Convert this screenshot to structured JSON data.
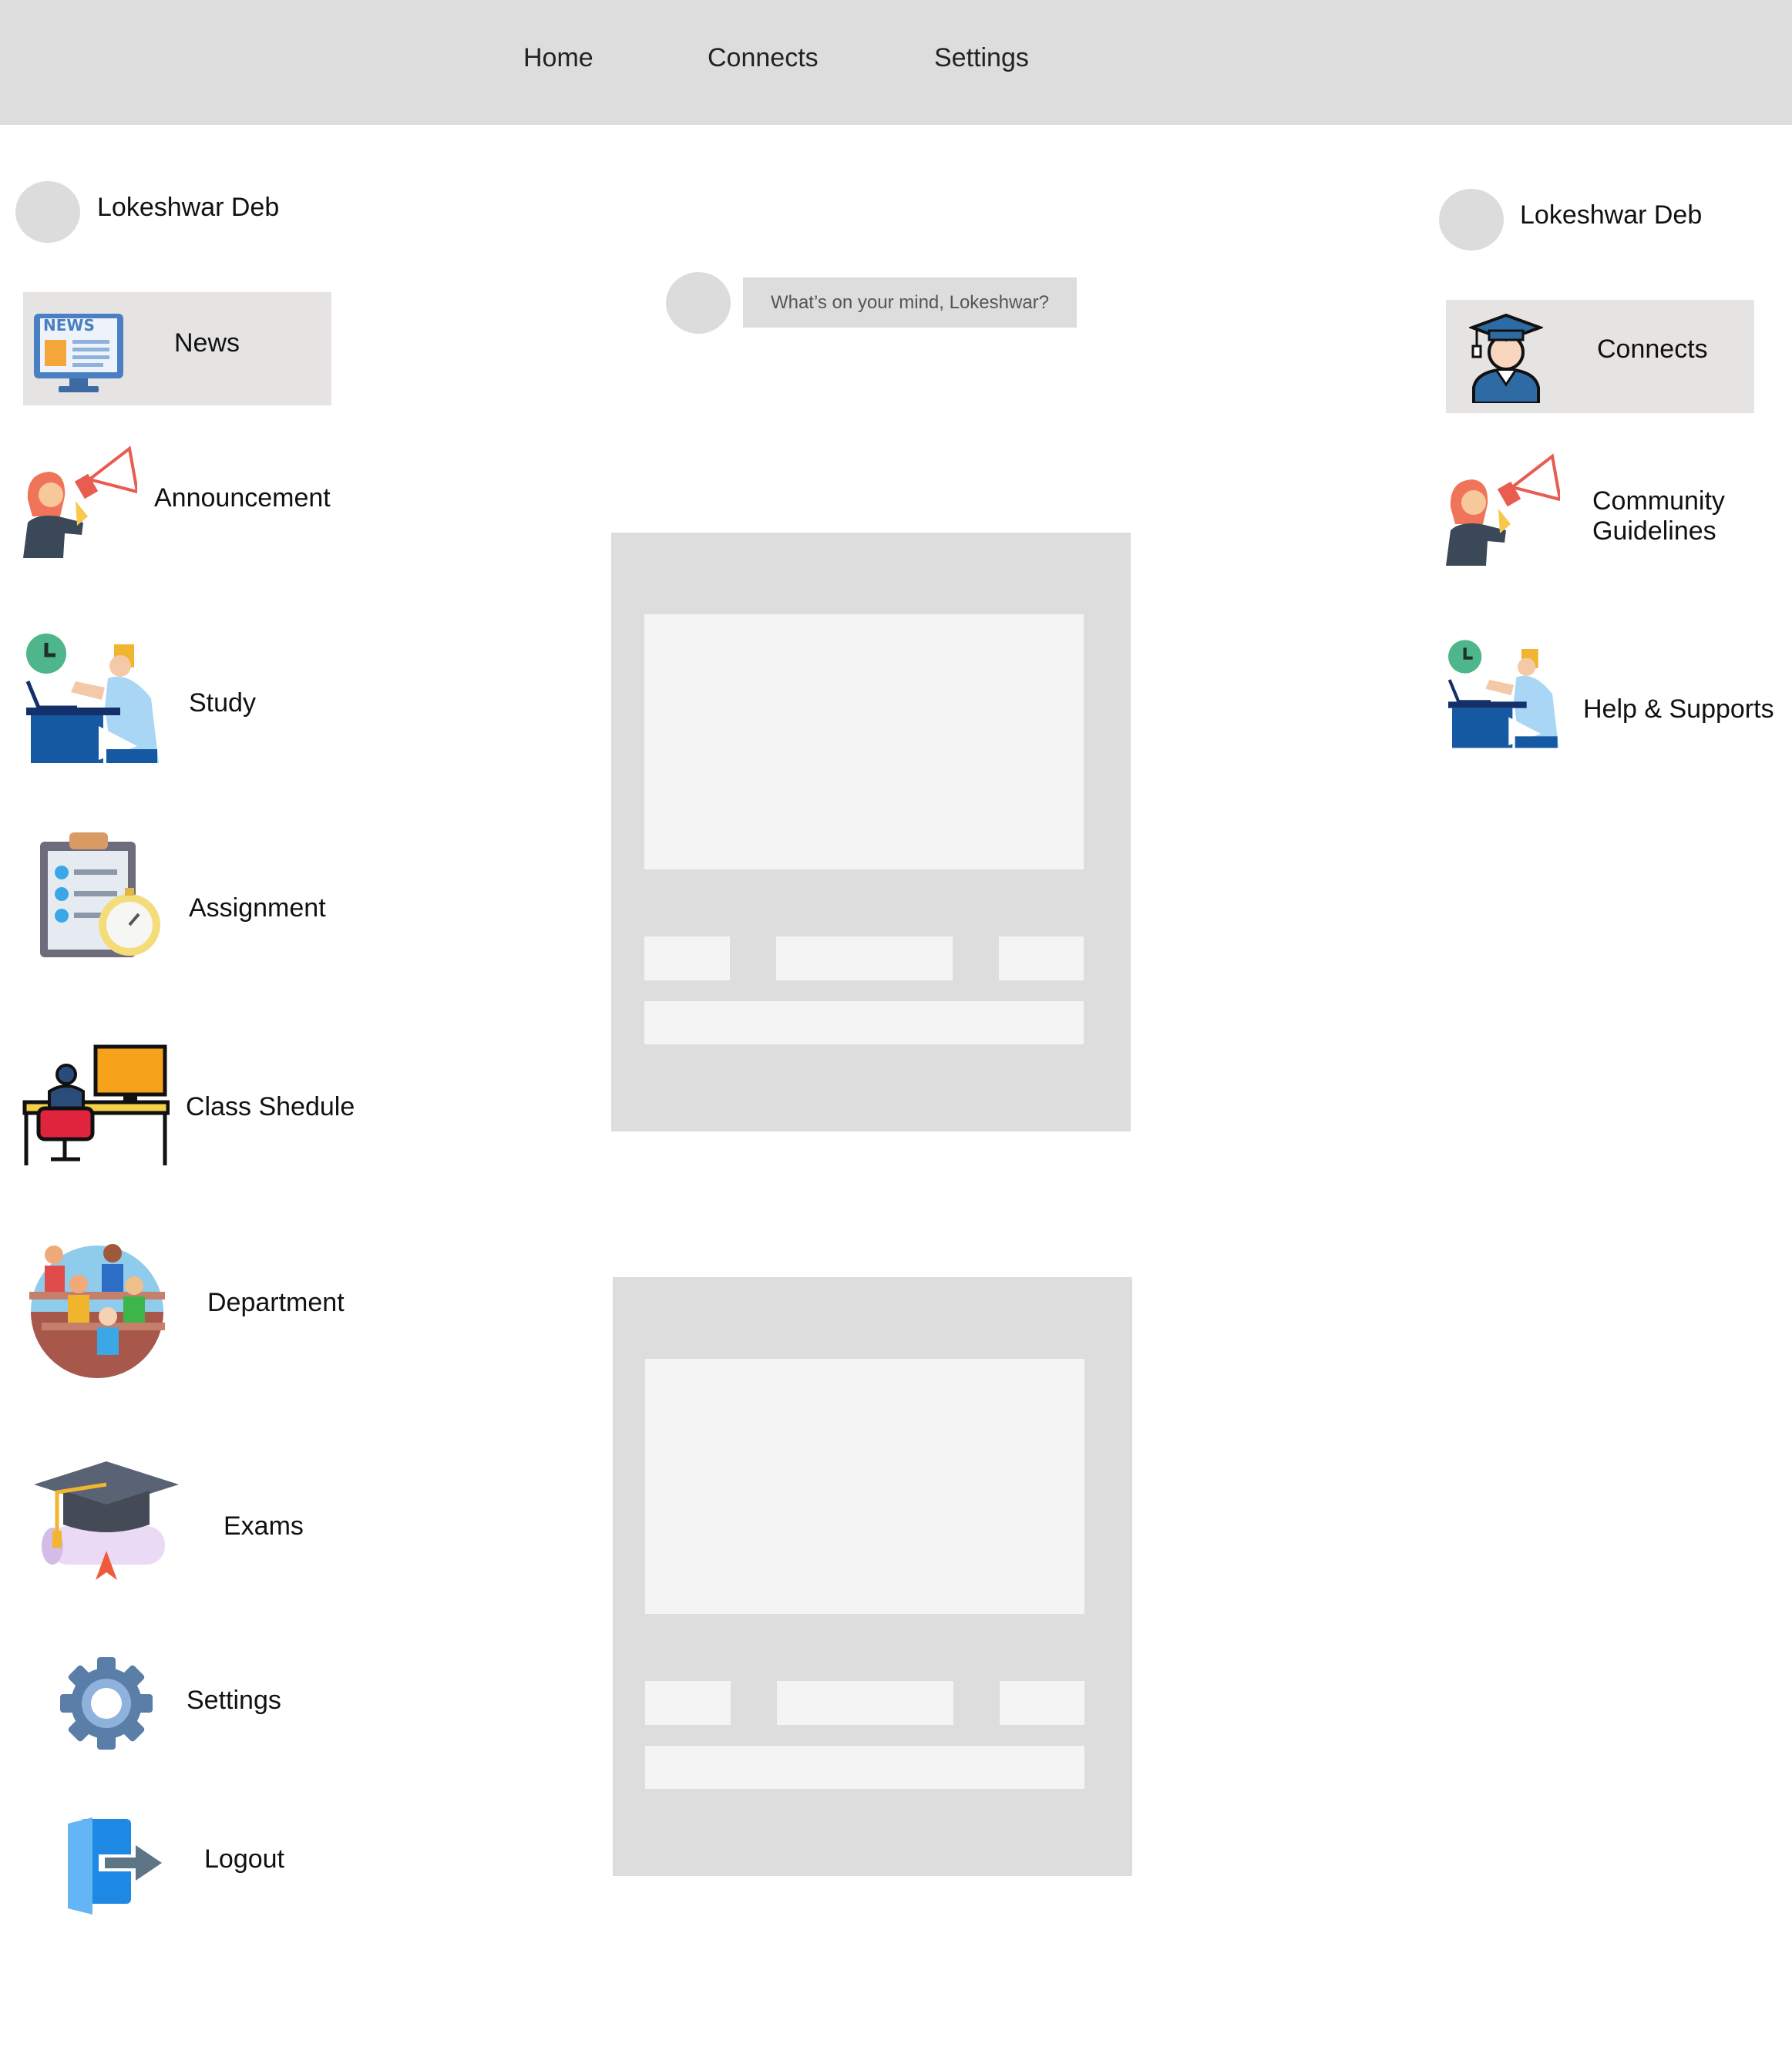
{
  "nav": {
    "items": [
      "Home",
      "Connects",
      "Settings"
    ]
  },
  "left_sidebar": {
    "profile_name": "Lokeshwar Deb",
    "items": [
      {
        "label": "News",
        "icon": "news-monitor-icon",
        "active": true
      },
      {
        "label": "Announcement",
        "icon": "megaphone-person-icon"
      },
      {
        "label": "Study",
        "icon": "study-desk-icon"
      },
      {
        "label": "Assignment",
        "icon": "clipboard-stopwatch-icon"
      },
      {
        "label": "Class Shedule",
        "icon": "desk-computer-icon"
      },
      {
        "label": "Department",
        "icon": "classroom-people-icon"
      },
      {
        "label": "Exams",
        "icon": "graduation-cap-icon"
      },
      {
        "label": "Settings",
        "icon": "gear-icon"
      },
      {
        "label": "Logout",
        "icon": "logout-door-icon"
      }
    ]
  },
  "composer": {
    "placeholder": "What’s on your mind, Lokeshwar?"
  },
  "right_sidebar": {
    "profile_name": "Lokeshwar Deb",
    "items": [
      {
        "label": "Connects",
        "icon": "graduate-person-icon",
        "active": true
      },
      {
        "label_line1": "Community",
        "label_line2": "Guidelines",
        "icon": "megaphone-person-icon"
      },
      {
        "label": "Help & Supports",
        "icon": "study-desk-icon"
      }
    ]
  },
  "colors": {
    "topbar": "#dddddd",
    "placeholder_card": "#dddddd",
    "placeholder_block": "#f4f4f4",
    "active_item": "#e6e4e3"
  }
}
